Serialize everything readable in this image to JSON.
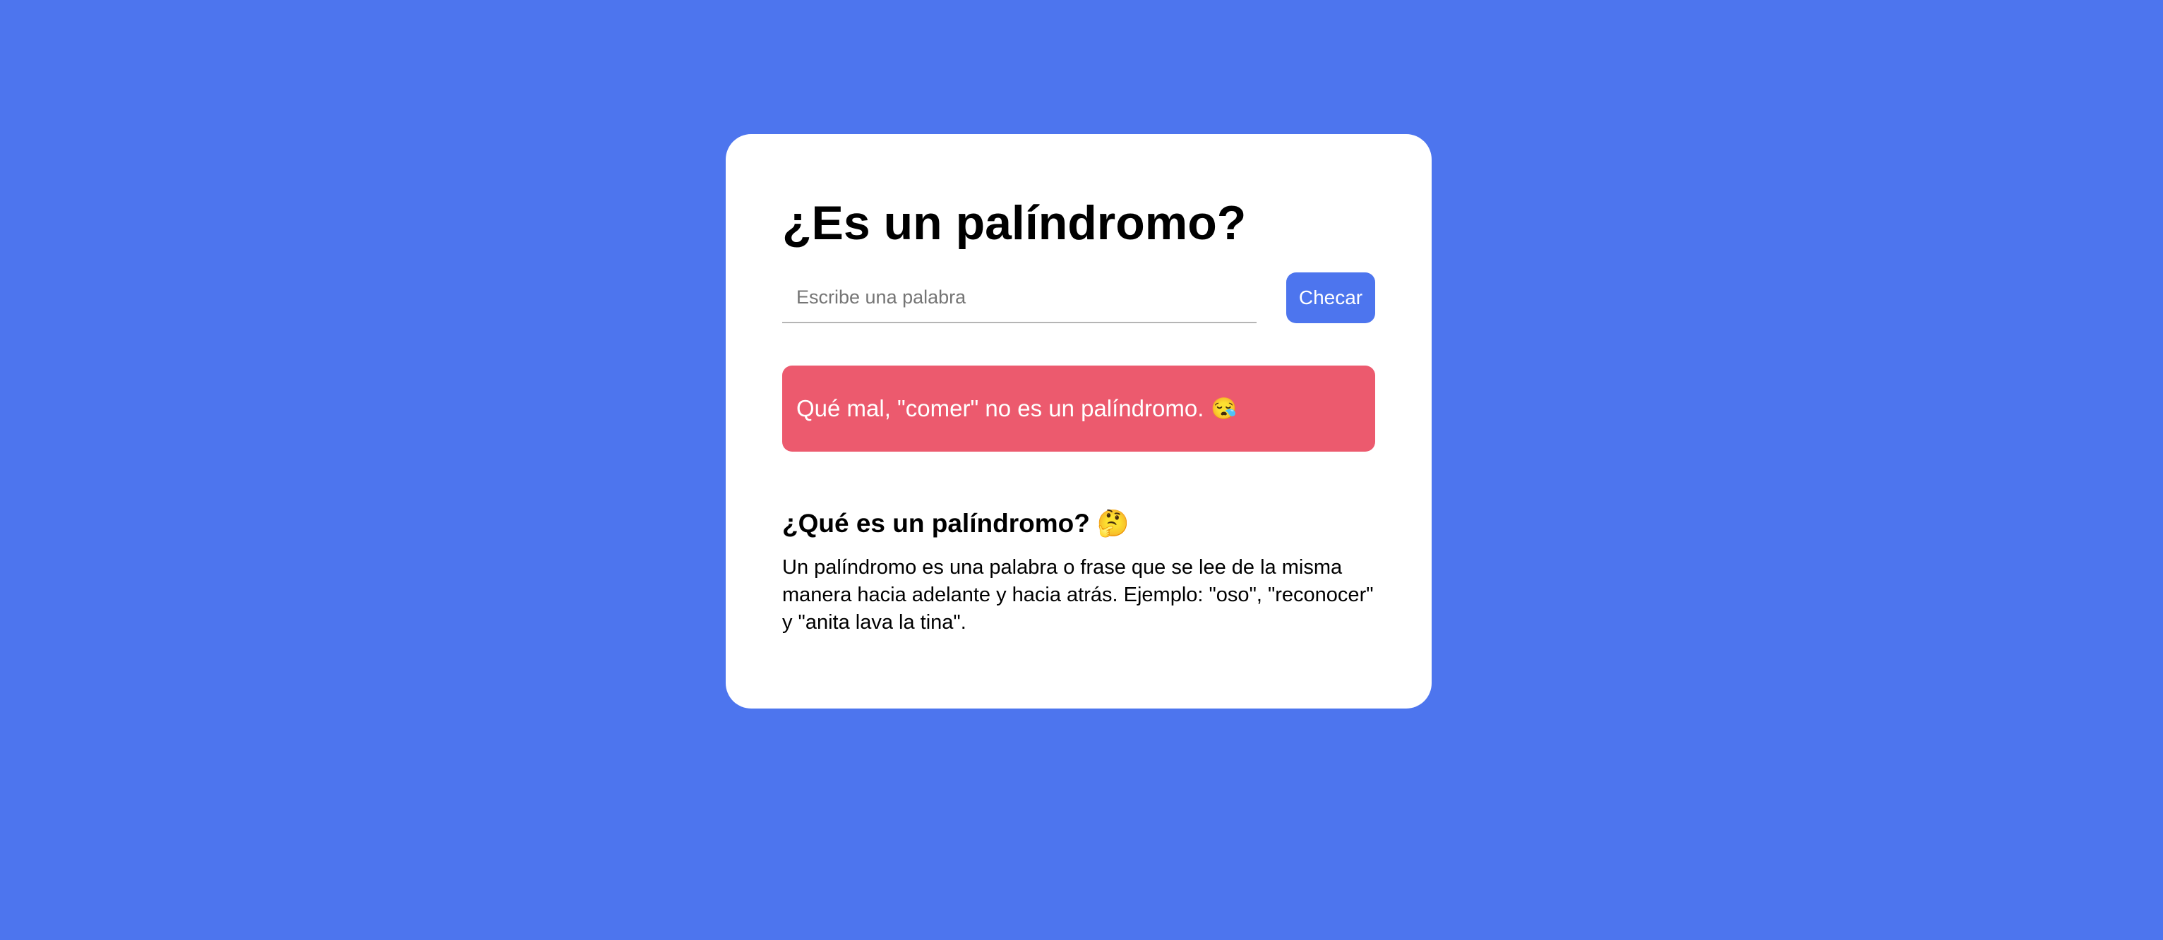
{
  "page": {
    "background_color": "#4d75ee"
  },
  "card": {
    "title": "¿Es un palíndromo?",
    "input": {
      "placeholder": "Escribe una palabra",
      "value": ""
    },
    "check_button_label": "Checar",
    "result": {
      "message": "Qué mal, \"comer\" no es un palíndromo.",
      "emoji": "😪",
      "color": "#ec5a6e"
    },
    "info": {
      "title": "¿Qué es un palíndromo?",
      "title_emoji": "🤔",
      "text": "Un palíndromo es una palabra o frase que se lee de la misma manera hacia adelante y hacia atrás. Ejemplo: \"oso\", \"reconocer\" y \"anita lava la tina\"."
    }
  }
}
